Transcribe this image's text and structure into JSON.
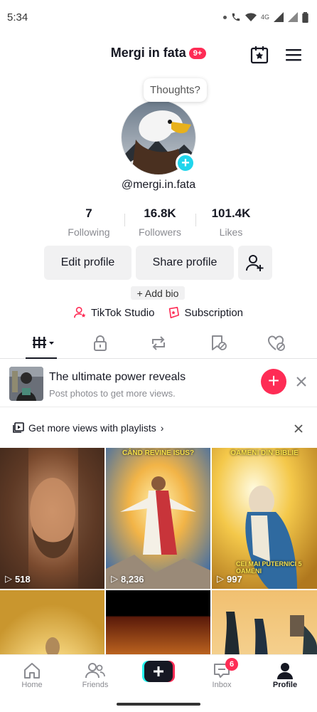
{
  "status": {
    "time": "5:34",
    "network": "4G"
  },
  "header": {
    "title": "Mergi in fata",
    "badge": "9+"
  },
  "profile": {
    "thoughts_placeholder": "Thoughts?",
    "username": "@mergi.in.fata",
    "stats": [
      {
        "value": "7",
        "label": "Following"
      },
      {
        "value": "16.8K",
        "label": "Followers"
      },
      {
        "value": "101.4K",
        "label": "Likes"
      }
    ],
    "edit_label": "Edit profile",
    "share_label": "Share profile",
    "add_bio": "+ Add bio",
    "studio_label": "TikTok Studio",
    "subscription_label": "Subscription"
  },
  "promo": {
    "title": "The ultimate power reveals",
    "subtitle": "Post photos to get more views."
  },
  "playlist": {
    "text": "Get more views with playlists"
  },
  "videos": [
    {
      "views": "518",
      "caption": "",
      "caption2": ""
    },
    {
      "views": "8,236",
      "caption": "CÂND REVINE ISUS?",
      "caption2": ""
    },
    {
      "views": "997",
      "caption": "OAMENI DIN BIBLIE",
      "caption2": "CEI MAI PUTERNICI 5 OAMENI"
    },
    {
      "views": "",
      "caption": "",
      "caption2": ""
    },
    {
      "views": "",
      "caption": "",
      "caption2": ""
    },
    {
      "views": "",
      "caption": "",
      "caption2": ""
    }
  ],
  "nav": {
    "home": "Home",
    "friends": "Friends",
    "inbox": "Inbox",
    "inbox_badge": "6",
    "profile": "Profile"
  },
  "colors": {
    "accent": "#fe2c55",
    "cyan": "#20d5ec",
    "text": "#161823",
    "muted": "#8a8b91",
    "button_bg": "#f1f1f2"
  }
}
